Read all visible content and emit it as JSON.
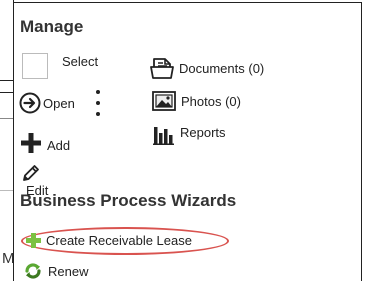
{
  "background": {
    "fragment_letter": "M"
  },
  "manage": {
    "title": "Manage",
    "select_label": "Select",
    "open_label": "Open",
    "add_label": "Add",
    "edit_label": "Edit",
    "documents_label": "Documents (0)",
    "photos_label": "Photos (0)",
    "reports_label": "Reports"
  },
  "wizards": {
    "title": "Business Process Wizards",
    "create_label": "Create Receivable Lease",
    "renew_label": "Renew"
  },
  "icons": {
    "open": "arrow-right-circle-icon",
    "more": "kebab-menu-icon",
    "add": "plus-icon",
    "edit": "pencil-icon",
    "documents": "document-icon",
    "photos": "photo-icon",
    "reports": "bar-chart-icon",
    "create": "green-plus-icon",
    "renew": "renew-icon"
  },
  "colors": {
    "highlight": "#d9534f",
    "create_plus": "#7cc142",
    "renew": "#5aa832"
  }
}
